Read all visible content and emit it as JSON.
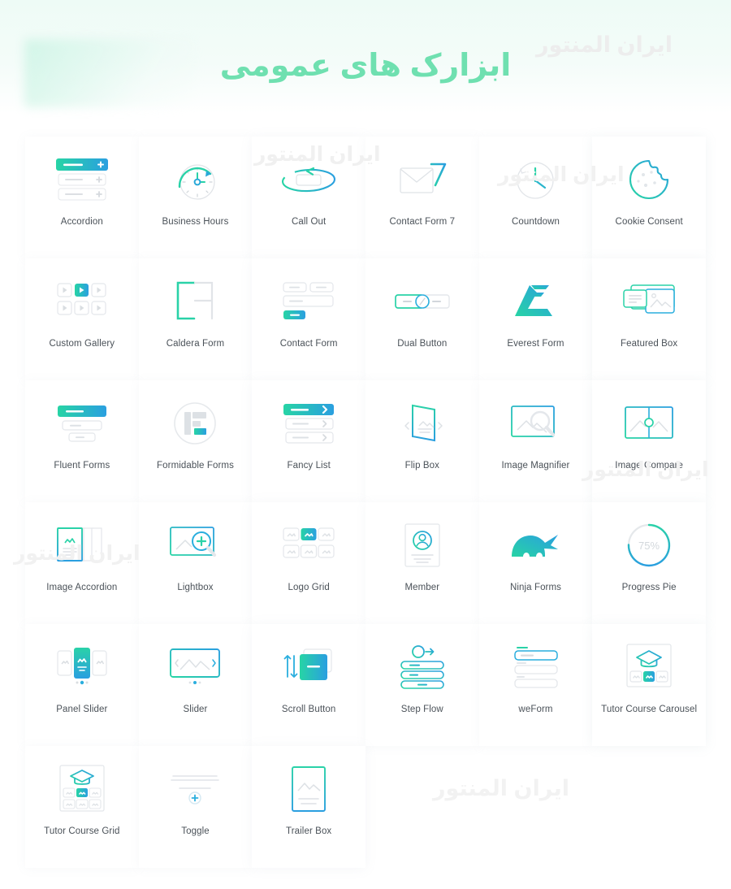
{
  "header": {
    "title": "ابزارک های عمومی"
  },
  "watermark": {
    "text": "ایران المنتور",
    "instances": [
      "ایران المنتور",
      "ایران المنتور",
      "ایران المنتور",
      "ایران المنتور",
      "ایران المنتور",
      "ایران المنتور"
    ]
  },
  "colors": {
    "accent_green": "#2ad2a8",
    "accent_blue": "#2a9fe0",
    "title_green": "#6fe0b0",
    "label_text": "#4a5158",
    "muted_outline": "#e3e6ea",
    "watermark": "#f0f0f0",
    "page_background": "#ffffff",
    "hero_background": "#eefbf6"
  },
  "widgets": [
    {
      "label": "Accordion",
      "icon": "accordion-icon"
    },
    {
      "label": "Business Hours",
      "icon": "business-hours-clock-icon"
    },
    {
      "label": "Call Out",
      "icon": "call-out-icon"
    },
    {
      "label": "Contact Form 7",
      "icon": "contact-form-7-envelope-icon"
    },
    {
      "label": "Countdown",
      "icon": "countdown-clock-icon"
    },
    {
      "label": "Cookie Consent",
      "icon": "cookie-consent-icon"
    },
    {
      "label": "Custom Gallery",
      "icon": "custom-gallery-icon"
    },
    {
      "label": "Caldera Form",
      "icon": "caldera-form-icon"
    },
    {
      "label": "Contact Form",
      "icon": "contact-form-icon"
    },
    {
      "label": "Dual Button",
      "icon": "dual-button-icon"
    },
    {
      "label": "Everest Form",
      "icon": "everest-form-icon"
    },
    {
      "label": "Featured Box",
      "icon": "featured-box-icon"
    },
    {
      "label": "Fluent Forms",
      "icon": "fluent-forms-icon"
    },
    {
      "label": "Formidable Forms",
      "icon": "formidable-forms-icon"
    },
    {
      "label": "Fancy List",
      "icon": "fancy-list-icon"
    },
    {
      "label": "Flip Box",
      "icon": "flip-box-icon"
    },
    {
      "label": "Image Magnifier",
      "icon": "image-magnifier-icon"
    },
    {
      "label": "Image Compare",
      "icon": "image-compare-icon"
    },
    {
      "label": "Image Accordion",
      "icon": "image-accordion-icon"
    },
    {
      "label": "Lightbox",
      "icon": "lightbox-icon"
    },
    {
      "label": "Logo Grid",
      "icon": "logo-grid-icon"
    },
    {
      "label": "Member",
      "icon": "member-card-icon"
    },
    {
      "label": "Ninja Forms",
      "icon": "ninja-forms-icon"
    },
    {
      "label": "Progress Pie",
      "icon": "progress-pie-icon",
      "value": "75%"
    },
    {
      "label": "Panel Slider",
      "icon": "panel-slider-icon"
    },
    {
      "label": "Slider",
      "icon": "slider-icon"
    },
    {
      "label": "Scroll Button",
      "icon": "scroll-button-icon"
    },
    {
      "label": "Step Flow",
      "icon": "step-flow-icon"
    },
    {
      "label": "weForm",
      "icon": "weform-icon"
    },
    {
      "label": "Tutor Course Carousel",
      "icon": "tutor-course-carousel-icon"
    },
    {
      "label": "Tutor Course Grid",
      "icon": "tutor-course-grid-icon"
    },
    {
      "label": "Toggle",
      "icon": "toggle-icon"
    },
    {
      "label": "Trailer Box",
      "icon": "trailer-box-icon"
    }
  ]
}
